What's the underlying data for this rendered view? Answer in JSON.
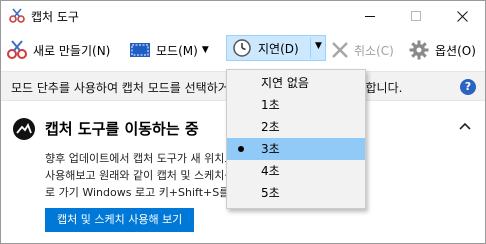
{
  "window": {
    "title": "캡처 도구"
  },
  "toolbar": {
    "new_label": "새로 만들기(N)",
    "mode_label": "모드(M)",
    "delay_label": "지연(D)",
    "cancel_label": "취소(C)",
    "options_label": "옵션(O)"
  },
  "infobar": {
    "text": "모드 단추를 사용하여 캡처 모드를 선택하거나 새로 만들기 단추를 클릭합니다."
  },
  "notice": {
    "title": "캡처 도구를 이동하는 중",
    "body": "향후 업데이트에서 캡처 도구가 새 위치로 이동합니다. 향상된 기능을\n사용해보고 원래와 같이 캡처 및 스케치를 사용해 보세요(또는 바\n로 가기 Windows 로고 키+Shift+S를 사용해 보세요).",
    "button_label": "캡처 및 스케치 사용해 보기"
  },
  "delay_menu": {
    "items": [
      {
        "label": "지연 없음",
        "selected": false
      },
      {
        "label": "1초",
        "selected": false
      },
      {
        "label": "2초",
        "selected": false
      },
      {
        "label": "3초",
        "selected": true
      },
      {
        "label": "4초",
        "selected": false
      },
      {
        "label": "5초",
        "selected": false
      }
    ]
  },
  "colors": {
    "accent": "#0078d7",
    "highlight": "#91c9f7",
    "toolbar_hover": "#cce8ff",
    "help_icon": "#2b63c1"
  }
}
